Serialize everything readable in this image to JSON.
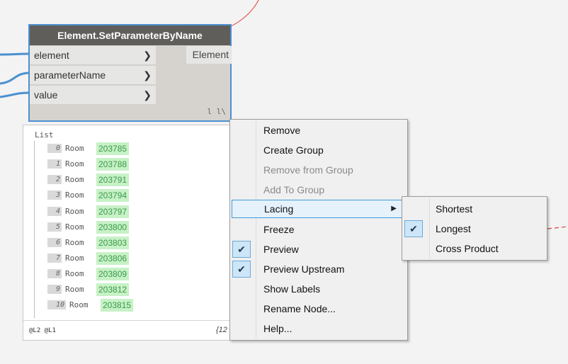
{
  "node": {
    "title": "Element.SetParameterByName",
    "inputs": [
      "element",
      "parameterName",
      "value"
    ],
    "output": "Element",
    "lacing_indicator": "l l\\"
  },
  "preview": {
    "title": "List",
    "rows": [
      {
        "index": "0",
        "type": "Room",
        "value": "203785"
      },
      {
        "index": "1",
        "type": "Room",
        "value": "203788"
      },
      {
        "index": "2",
        "type": "Room",
        "value": "203791"
      },
      {
        "index": "3",
        "type": "Room",
        "value": "203794"
      },
      {
        "index": "4",
        "type": "Room",
        "value": "203797"
      },
      {
        "index": "5",
        "type": "Room",
        "value": "203800"
      },
      {
        "index": "6",
        "type": "Room",
        "value": "203803"
      },
      {
        "index": "7",
        "type": "Room",
        "value": "203806"
      },
      {
        "index": "8",
        "type": "Room",
        "value": "203809"
      },
      {
        "index": "9",
        "type": "Room",
        "value": "203812"
      },
      {
        "index": "10",
        "type": "Room",
        "value": "203815"
      }
    ],
    "levels": "@L2 @L1",
    "count": "{12"
  },
  "menu": {
    "items": [
      {
        "label": "Remove",
        "enabled": true
      },
      {
        "label": "Create Group",
        "enabled": true
      },
      {
        "label": "Remove from Group",
        "enabled": false
      },
      {
        "label": "Add To Group",
        "enabled": false
      },
      {
        "label": "Lacing",
        "enabled": true,
        "submenu": true
      },
      {
        "label": "Freeze",
        "enabled": true
      },
      {
        "label": "Preview",
        "enabled": true,
        "checked": true
      },
      {
        "label": "Preview Upstream",
        "enabled": true,
        "checked": true
      },
      {
        "label": "Show Labels",
        "enabled": true
      },
      {
        "label": "Rename Node...",
        "enabled": true
      },
      {
        "label": "Help...",
        "enabled": true
      }
    ]
  },
  "lacing_submenu": {
    "items": [
      {
        "label": "Shortest",
        "checked": false
      },
      {
        "label": "Longest",
        "checked": true
      },
      {
        "label": "Cross Product",
        "checked": false
      }
    ]
  },
  "colors": {
    "wire": "#4a90d0",
    "node_border": "#4e8fd0",
    "value_bg": "#c7f1c6",
    "dashed_wire": "#e04040"
  }
}
